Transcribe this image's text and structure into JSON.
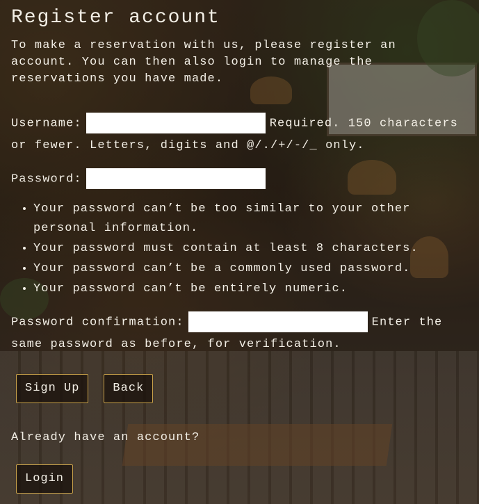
{
  "page": {
    "title": "Register account",
    "intro": "To make a reservation with us, please register an account. You can then also login to manage the reservations you have made."
  },
  "form": {
    "username": {
      "label": "Username:",
      "value": "",
      "help": "Required. 150 characters or fewer. Letters, digits and @/./+/-/_ only."
    },
    "password": {
      "label": "Password:",
      "value": "",
      "rules": [
        "Your password can’t be too similar to your other personal information.",
        "Your password must contain at least 8 characters.",
        "Your password can’t be a commonly used password.",
        "Your password can’t be entirely numeric."
      ]
    },
    "password_confirmation": {
      "label": "Password confirmation:",
      "value": "",
      "help": "Enter the same password as before, for verification."
    }
  },
  "buttons": {
    "sign_up": "Sign Up",
    "back": "Back",
    "login": "Login"
  },
  "login_prompt": "Already have an account?",
  "colors": {
    "button_border": "#c9a24a",
    "text": "#f3efe6"
  }
}
